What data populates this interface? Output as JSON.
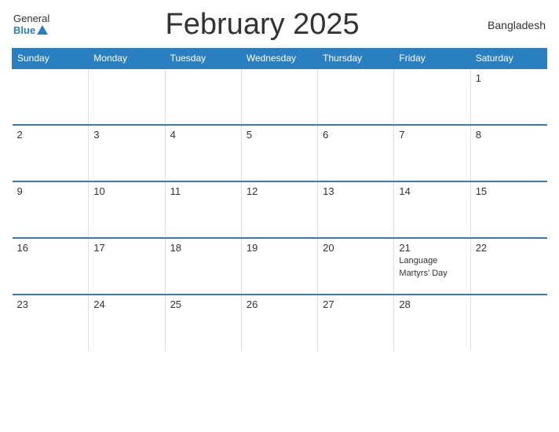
{
  "header": {
    "logo_general": "General",
    "logo_blue": "Blue",
    "month_title": "February 2025",
    "country": "Bangladesh"
  },
  "weekdays": [
    "Sunday",
    "Monday",
    "Tuesday",
    "Wednesday",
    "Thursday",
    "Friday",
    "Saturday"
  ],
  "weeks": [
    [
      {
        "day": "",
        "holiday": ""
      },
      {
        "day": "",
        "holiday": ""
      },
      {
        "day": "",
        "holiday": ""
      },
      {
        "day": "",
        "holiday": ""
      },
      {
        "day": "",
        "holiday": ""
      },
      {
        "day": "",
        "holiday": ""
      },
      {
        "day": "1",
        "holiday": ""
      }
    ],
    [
      {
        "day": "2",
        "holiday": ""
      },
      {
        "day": "3",
        "holiday": ""
      },
      {
        "day": "4",
        "holiday": ""
      },
      {
        "day": "5",
        "holiday": ""
      },
      {
        "day": "6",
        "holiday": ""
      },
      {
        "day": "7",
        "holiday": ""
      },
      {
        "day": "8",
        "holiday": ""
      }
    ],
    [
      {
        "day": "9",
        "holiday": ""
      },
      {
        "day": "10",
        "holiday": ""
      },
      {
        "day": "11",
        "holiday": ""
      },
      {
        "day": "12",
        "holiday": ""
      },
      {
        "day": "13",
        "holiday": ""
      },
      {
        "day": "14",
        "holiday": ""
      },
      {
        "day": "15",
        "holiday": ""
      }
    ],
    [
      {
        "day": "16",
        "holiday": ""
      },
      {
        "day": "17",
        "holiday": ""
      },
      {
        "day": "18",
        "holiday": ""
      },
      {
        "day": "19",
        "holiday": ""
      },
      {
        "day": "20",
        "holiday": ""
      },
      {
        "day": "21",
        "holiday": "Language Martyrs' Day"
      },
      {
        "day": "22",
        "holiday": ""
      }
    ],
    [
      {
        "day": "23",
        "holiday": ""
      },
      {
        "day": "24",
        "holiday": ""
      },
      {
        "day": "25",
        "holiday": ""
      },
      {
        "day": "26",
        "holiday": ""
      },
      {
        "day": "27",
        "holiday": ""
      },
      {
        "day": "28",
        "holiday": ""
      },
      {
        "day": "",
        "holiday": ""
      }
    ]
  ],
  "colors": {
    "header_bg": "#2a7fc1",
    "accent": "#2a7fc1"
  }
}
